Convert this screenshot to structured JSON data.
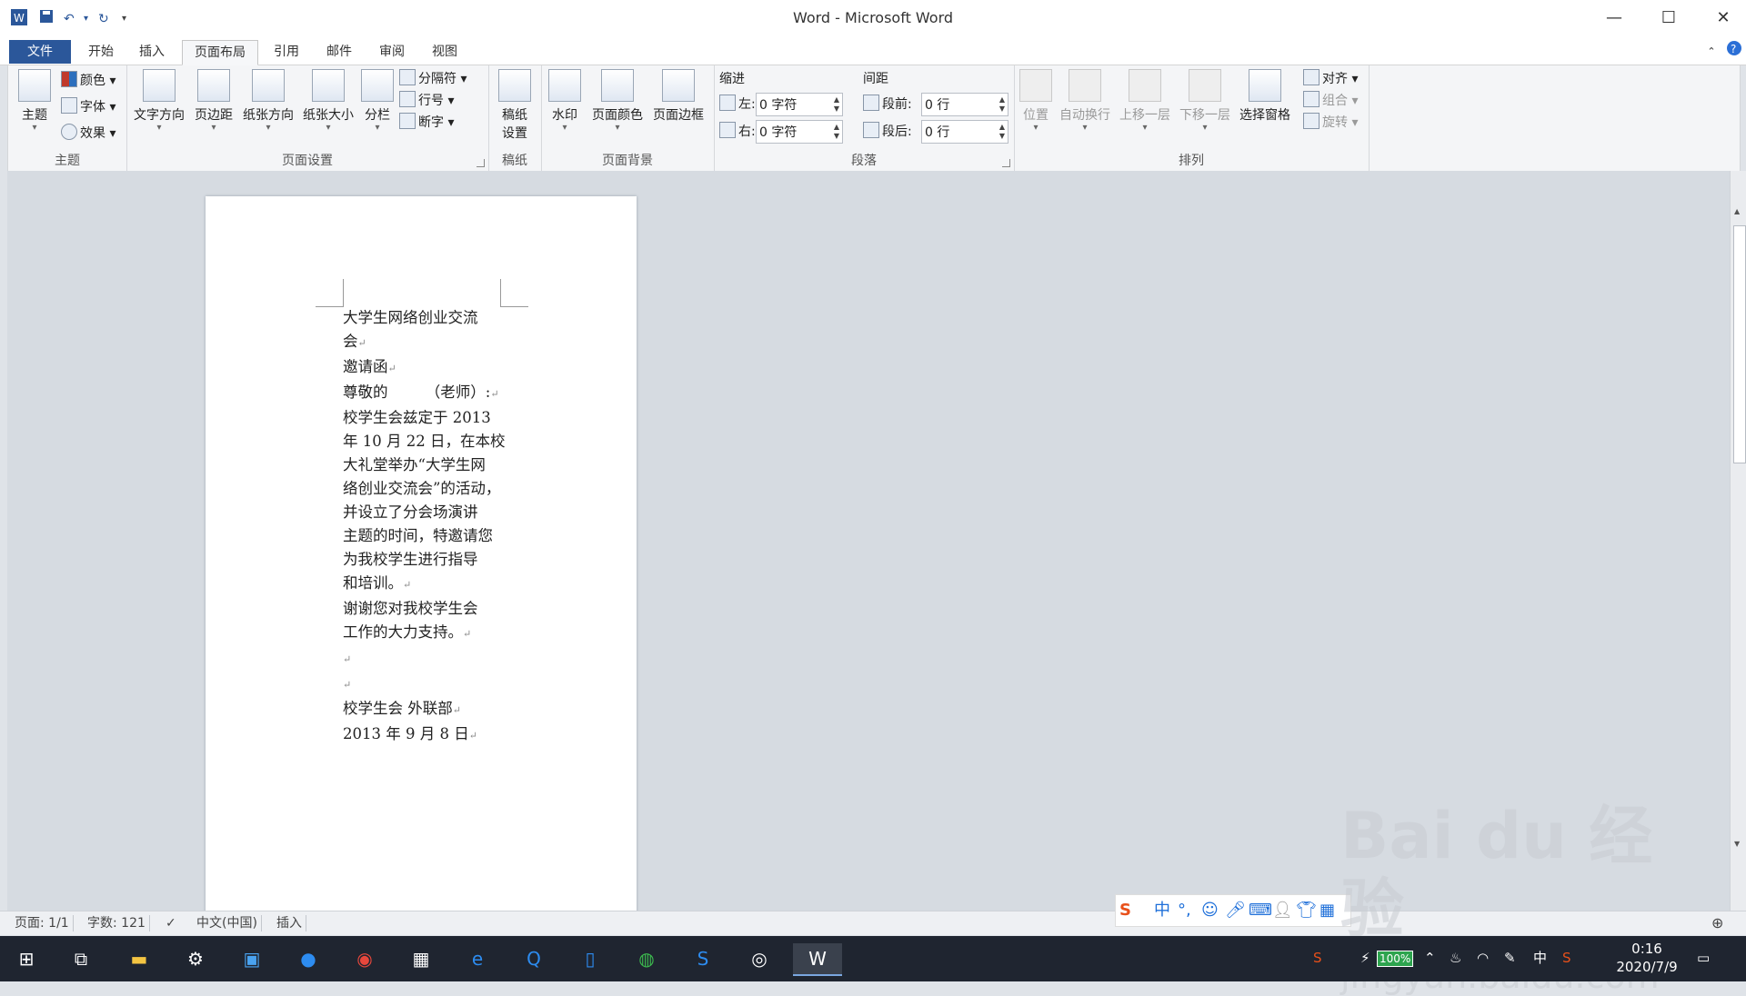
{
  "window": {
    "title": "Word - Microsoft Word"
  },
  "quick_access": {
    "app_icon": "word-icon",
    "save_icon": "save-icon",
    "undo_icon": "undo-icon",
    "redo_icon": "redo-icon",
    "customize_icon": "customize-icon"
  },
  "tabs": [
    {
      "label": "文件"
    },
    {
      "label": "开始"
    },
    {
      "label": "插入"
    },
    {
      "label": "页面布局"
    },
    {
      "label": "引用"
    },
    {
      "label": "邮件"
    },
    {
      "label": "审阅"
    },
    {
      "label": "视图"
    }
  ],
  "ribbon": {
    "themes": {
      "label": "主题",
      "theme_btn": "主题",
      "colors": "颜色",
      "fonts": "字体",
      "effects": "效果"
    },
    "page_setup": {
      "label": "页面设置",
      "text_direction": "文字方向",
      "margins": "页边距",
      "orientation": "纸张方向",
      "size": "纸张大小",
      "columns": "分栏",
      "breaks": "分隔符",
      "line_numbers": "行号",
      "hyphenation": "断字"
    },
    "manuscript": {
      "label": "稿纸",
      "btn_line1": "稿纸",
      "btn_line2": "设置"
    },
    "page_background": {
      "label": "页面背景",
      "watermark": "水印",
      "page_color": "页面颜色",
      "page_borders": "页面边框"
    },
    "paragraph": {
      "label": "段落",
      "indent": "缩进",
      "left": "左:",
      "left_value": "0 字符",
      "right": "右:",
      "right_value": "0 字符",
      "spacing": "间距",
      "before": "段前:",
      "before_value": "0 行",
      "after": "段后:",
      "after_value": "0 行"
    },
    "arrange": {
      "label": "排列",
      "position": "位置",
      "wrap": "自动换行",
      "bring_forward": "上移一层",
      "send_backward": "下移一层",
      "selection_pane": "选择窗格",
      "align": "对齐",
      "group": "组合",
      "rotate": "旋转"
    }
  },
  "document": {
    "lines": [
      "大学生网络创业交流",
      "会",
      "邀请函",
      "尊敬的　　　（老师）:",
      "校学生会兹定于 2013",
      "年 10 月 22 日，在本校",
      "大礼堂举办“大学生网",
      "络创业交流会”的活动，",
      "并设立了分会场演讲",
      "主题的时间，特邀请您",
      "为我校学生进行指导",
      "和培训。",
      "谢谢您对我校学生会",
      "工作的大力支持。",
      "",
      "",
      "校学生会 外联部",
      "2013 年 9 月 8 日"
    ],
    "paragraph_mark": "↵"
  },
  "status_bar": {
    "page": "页面: 1/1",
    "words": "字数: 121",
    "language": "中文(中国)",
    "mode": "插入"
  },
  "ime_bar": {
    "brand": "S",
    "mode": "中"
  },
  "taskbar": {
    "battery": "100%",
    "ime": "中",
    "time": "0:16",
    "date": "2020/7/9"
  },
  "watermark": {
    "text_top": "Bai du 经验",
    "text_bottom": "jingyan.baidu.com"
  }
}
